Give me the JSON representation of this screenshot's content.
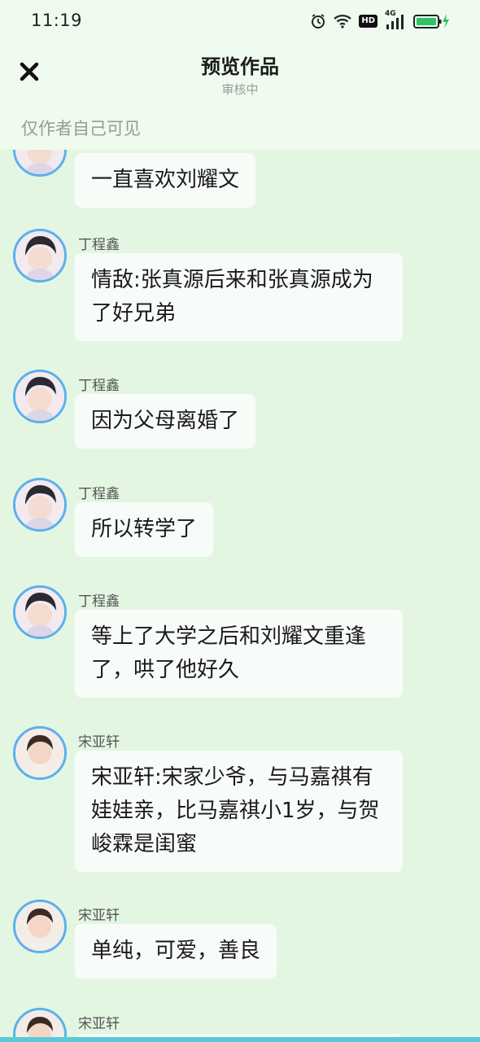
{
  "status_bar": {
    "time": "11:19",
    "hd_label": "HD",
    "network_label": "4G"
  },
  "header": {
    "title": "预览作品",
    "subtitle": "审核中"
  },
  "visibility": {
    "text": "仅作者自己可见"
  },
  "messages": [
    {
      "sender": "",
      "text": "一直喜欢刘耀文"
    },
    {
      "sender": "丁程鑫",
      "text": "情敌:张真源后来和张真源成为了好兄弟"
    },
    {
      "sender": "丁程鑫",
      "text": "因为父母离婚了"
    },
    {
      "sender": "丁程鑫",
      "text": "所以转学了"
    },
    {
      "sender": "丁程鑫",
      "text": "等上了大学之后和刘耀文重逢了，哄了他好久"
    },
    {
      "sender": "宋亚轩",
      "text": "宋亚轩:宋家少爷，与马嘉祺有娃娃亲，比马嘉祺小1岁，与贺峻霖是闺蜜"
    },
    {
      "sender": "宋亚轩",
      "text": "单纯，可爱，善良"
    },
    {
      "sender": "宋亚轩",
      "text": ""
    }
  ],
  "colors": {
    "background": "#e2f6e2",
    "bubble": "#f8fcf8",
    "avatar_ring": "#5ab0ec",
    "battery": "#2fc163"
  }
}
